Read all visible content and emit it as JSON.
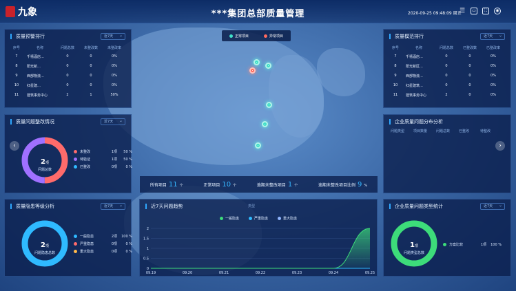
{
  "header": {
    "logo_text": "九象",
    "title": "***集团总部质量管理",
    "datetime": "2020-09-25 09:48:09 周五",
    "icons": [
      "filter-icon",
      "screen-icon",
      "fullscreen-icon",
      "user-icon"
    ]
  },
  "warning_rank": {
    "title": "质量预警排行",
    "select": "近7天",
    "headers": [
      "序号",
      "名称",
      "问题总数",
      "未整改数",
      "未整改率"
    ],
    "rows": [
      [
        "7",
        "千禧酒店…",
        "0",
        "0",
        "0%"
      ],
      [
        "8",
        "阳光新…",
        "0",
        "0",
        "0%"
      ],
      [
        "9",
        "西部物流…",
        "0",
        "0",
        "0%"
      ],
      [
        "10",
        "红星建…",
        "0",
        "0",
        "0%"
      ],
      [
        "11",
        "建筑事务中心",
        "2",
        "1",
        "50%"
      ]
    ]
  },
  "standard_rank": {
    "title": "质量模范排行",
    "select": "近7天",
    "headers": [
      "序号",
      "名称",
      "问题总数",
      "已整改数",
      "已整改率"
    ],
    "rows": [
      [
        "7",
        "千禧酒店…",
        "0",
        "0",
        "0%"
      ],
      [
        "8",
        "阳光新区…",
        "0",
        "0",
        "0%"
      ],
      [
        "9",
        "西部物流…",
        "0",
        "0",
        "0%"
      ],
      [
        "10",
        "红星建筑…",
        "0",
        "0",
        "0%"
      ],
      [
        "11",
        "建筑事务中心",
        "2",
        "0",
        "0%"
      ]
    ]
  },
  "rectification": {
    "title": "质量问题整改情况",
    "select": "近7天",
    "center_value": "2",
    "center_unit": "项",
    "center_label": "问题总数",
    "items": [
      {
        "label": "未整改",
        "count": "1项",
        "pct": "50 %",
        "color": "#ff6b6b"
      },
      {
        "label": "待验证",
        "count": "1项",
        "pct": "50 %",
        "color": "#a070ff"
      },
      {
        "label": "已整改",
        "count": "0项",
        "pct": "0 %",
        "color": "#2fbaff"
      }
    ]
  },
  "level_analysis": {
    "title": "质量隐患等级分析",
    "select": "近7天",
    "center_value": "2",
    "center_unit": "项",
    "center_label": "问题隐患总数",
    "items": [
      {
        "label": "一般隐患",
        "count": "2项",
        "pct": "100 %",
        "color": "#2fbaff"
      },
      {
        "label": "严重隐患",
        "count": "0项",
        "pct": "0 %",
        "color": "#ff6b6b"
      },
      {
        "label": "重大隐患",
        "count": "0项",
        "pct": "0 %",
        "color": "#ffb84a"
      }
    ]
  },
  "category_stats": {
    "title": "企业质量问题类型统计",
    "select": "近7天",
    "center_value": "1",
    "center_unit": "项",
    "center_label": "问题类型总数",
    "items": [
      {
        "label": "方案比较",
        "count": "1项",
        "pct": "100 %",
        "color": "#3ddc7a"
      }
    ]
  },
  "enterprise_distribution": {
    "title": "企业质量问题分布分析",
    "headers": [
      "问题类型",
      "项目数量",
      "问题总数",
      "已整改",
      "待整改"
    ]
  },
  "map": {
    "legend": [
      {
        "label": "正常项目",
        "color": "#3fe0c8"
      },
      {
        "label": "异常项目",
        "color": "#ff6a5e"
      }
    ]
  },
  "stats": {
    "items": [
      {
        "label": "所有项目",
        "value": "11",
        "unit": "个"
      },
      {
        "label": "正常项目",
        "value": "10",
        "unit": "个"
      },
      {
        "label": "逾期未整改项目",
        "value": "1",
        "unit": "个"
      },
      {
        "label": "逾期未整改项目比例",
        "value": "9",
        "unit": "%"
      }
    ]
  },
  "trend": {
    "title": "近7天问题趋势",
    "legend": [
      {
        "label": "一般隐患",
        "color": "#3ddc7a"
      },
      {
        "label": "严重隐患",
        "color": "#2fbaff"
      },
      {
        "label": "重大隐患",
        "color": "#8fb4ff"
      }
    ],
    "category_label": "类型"
  },
  "chart_data": {
    "type": "area",
    "title": "近7天问题趋势",
    "categories": [
      "09.19",
      "09.20",
      "09.21",
      "09.22",
      "09.23",
      "09.24",
      "09.25"
    ],
    "y_ticks": [
      "0",
      "0.5",
      "1",
      "1.5",
      "2"
    ],
    "ylim": [
      0,
      2
    ],
    "grid": true,
    "legend_position": "top",
    "series": [
      {
        "name": "一般隐患",
        "values": [
          0,
          0,
          0,
          0,
          0,
          0,
          2
        ],
        "color": "#3ddc7a"
      },
      {
        "name": "严重隐患",
        "values": [
          0,
          0,
          0,
          0,
          0,
          0,
          0
        ],
        "color": "#2fbaff"
      },
      {
        "name": "重大隐患",
        "values": [
          0,
          0,
          0,
          0,
          0,
          0,
          0
        ],
        "color": "#8fb4ff"
      }
    ]
  }
}
